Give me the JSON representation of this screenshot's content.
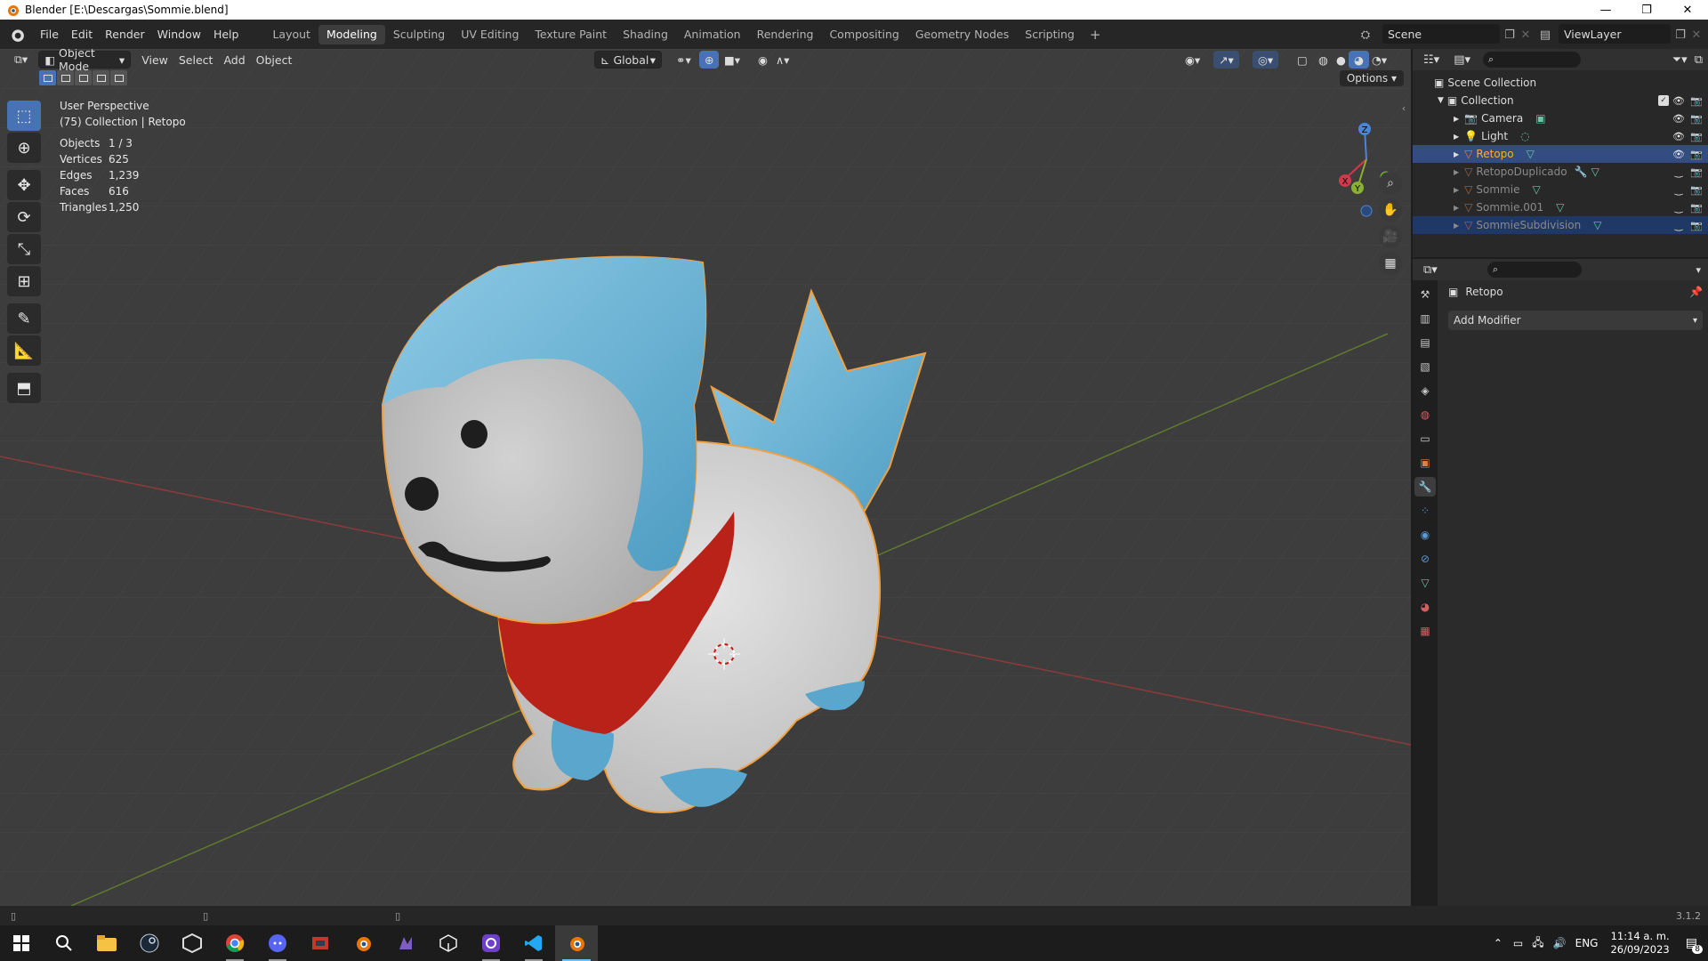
{
  "window": {
    "title": "Blender [E:\\Descargas\\Sommie.blend]",
    "minimize": "—",
    "restore": "❐",
    "close": "✕"
  },
  "menu": [
    "File",
    "Edit",
    "Render",
    "Window",
    "Help"
  ],
  "workspaces": [
    "Layout",
    "Modeling",
    "Sculpting",
    "UV Editing",
    "Texture Paint",
    "Shading",
    "Animation",
    "Rendering",
    "Compositing",
    "Geometry Nodes",
    "Scripting"
  ],
  "active_workspace": "Modeling",
  "scene": {
    "scene_name": "Scene",
    "view_layer": "ViewLayer"
  },
  "viewport_header": {
    "mode": "Object Mode",
    "menus": [
      "View",
      "Select",
      "Add",
      "Object"
    ],
    "transform_orientation": "Global",
    "options_label": "Options"
  },
  "viewport_info": {
    "perspective": "User Perspective",
    "collection": "(75) Collection | Retopo"
  },
  "stats": [
    {
      "label": "Objects",
      "value": "1 / 3"
    },
    {
      "label": "Vertices",
      "value": "625"
    },
    {
      "label": "Edges",
      "value": "1,239"
    },
    {
      "label": "Faces",
      "value": "616"
    },
    {
      "label": "Triangles",
      "value": "1,250"
    }
  ],
  "gizmo_axes": {
    "z": "Z",
    "x": "X",
    "y": "Y"
  },
  "outliner": {
    "root": "Scene Collection",
    "collection": "Collection",
    "objects": [
      {
        "name": "Camera",
        "hidden": false,
        "selected": false
      },
      {
        "name": "Light",
        "hidden": false,
        "selected": false
      },
      {
        "name": "Retopo",
        "hidden": false,
        "selected": true
      },
      {
        "name": "RetopoDuplicado",
        "hidden": true,
        "selected": false
      },
      {
        "name": "Sommie",
        "hidden": true,
        "selected": false
      },
      {
        "name": "Sommie.001",
        "hidden": true,
        "selected": false
      },
      {
        "name": "SommieSubdivision",
        "hidden": true,
        "selected": "dim"
      }
    ]
  },
  "properties": {
    "object_name": "Retopo",
    "add_modifier": "Add Modifier"
  },
  "statusbar": {
    "version": "3.1.2"
  },
  "taskbar": {
    "time": "11:14 a. m.",
    "date": "26/09/2023",
    "language": "ENG",
    "notifications": "8"
  },
  "colors": {
    "accent": "#4772b3",
    "viewport_bg": "#3d3d3d",
    "selection_outline": "#f0a040",
    "char_blue": "#6bb5d6",
    "char_red": "#c8281e"
  }
}
